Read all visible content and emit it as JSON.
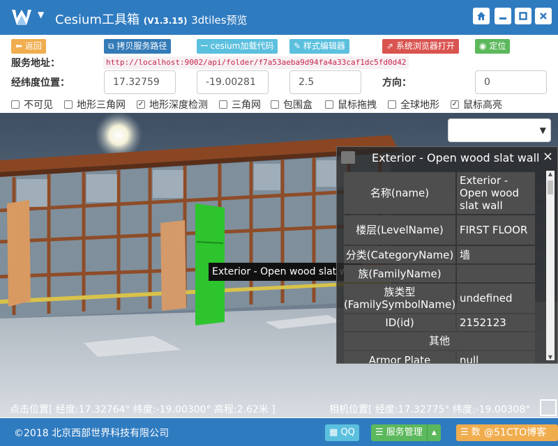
{
  "titlebar": {
    "title": "Cesium工具箱",
    "version": "(V1.3.15)",
    "subtitle": "3dtiles预览",
    "home_icon": "home-icon",
    "minimize_icon": "minimize-icon",
    "maximize_icon": "maximize-icon",
    "close_icon": "close-icon"
  },
  "toolbar": {
    "back": "返回",
    "copy_path": "拷贝服务路径",
    "cesium_code": "cesium加载代码",
    "style_editor": "样式编辑器",
    "open_browser": "系统浏览器打开",
    "locate": "定位"
  },
  "service": {
    "label": "服务地址：",
    "url": "http://localhost:9002/api/folder/f7a53aeba9d94fa4a33caf1dc5fd0d42"
  },
  "position": {
    "label": "经纬度位置：",
    "lon": "17.32759",
    "lat": "-19.00281",
    "height": "2.5",
    "heading_label": "方向：",
    "heading": "0"
  },
  "options": [
    {
      "label": "不可见",
      "checked": false
    },
    {
      "label": "地形三角网",
      "checked": false
    },
    {
      "label": "地形深度检测",
      "checked": true
    },
    {
      "label": "三角网",
      "checked": false
    },
    {
      "label": "包围盒",
      "checked": false
    },
    {
      "label": "鼠标拖拽",
      "checked": false
    },
    {
      "label": "全球地形",
      "checked": false
    },
    {
      "label": "鼠标高亮",
      "checked": true
    }
  ],
  "tooltip": "Exterior - Open wood slat wall",
  "panel": {
    "title": "Exterior - Open wood slat wall",
    "close": "×",
    "rows": [
      {
        "key": "名称(name)",
        "value": "Exterior - Open wood slat wall"
      },
      {
        "key": "楼层(LevelName)",
        "value": "FIRST FLOOR"
      },
      {
        "key": "分类(CategoryName)",
        "value": "墙"
      },
      {
        "key": "族(FamilyName)",
        "value": ""
      },
      {
        "key": "族类型(FamilySymbolName)",
        "value": "undefined"
      },
      {
        "key": "ID(id)",
        "value": "2152123"
      }
    ],
    "section": "其他",
    "partial_row": {
      "key": "Armor Plate",
      "value": "null"
    }
  },
  "status": {
    "click": "点击位置[ 经度:17.32764° 纬度:-19.00300° 高程:2.62米 ]",
    "camera": "相机位置[ 经度:17.32775° 纬度:-19.00308° 高"
  },
  "footer": {
    "copyright": "©2018 北京西部世界科技有限公司",
    "qq": "QQ",
    "service_mgmt": "服务管理",
    "data": "数",
    "watermark": "@51CTO博客"
  },
  "colors": {
    "primary": "#2f7bc0",
    "orange": "#f0ad4e",
    "red": "#d9534f",
    "green": "#5cb85c",
    "cyan": "#5bc0de",
    "blue": "#337ab7"
  }
}
